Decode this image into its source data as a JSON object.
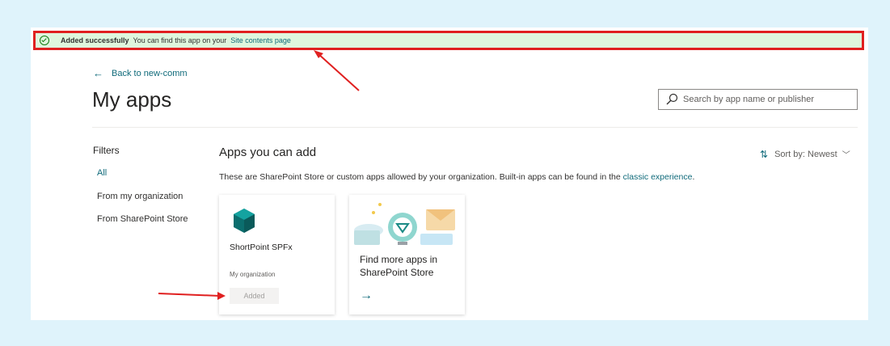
{
  "banner": {
    "strong": "Added successfully",
    "message": "You can find this app on your",
    "link": "Site contents page"
  },
  "back_link": "Back to new-comm",
  "page_title": "My apps",
  "search_placeholder": "Search by app name or publisher",
  "filters": {
    "title": "Filters",
    "items": [
      "All",
      "From my organization",
      "From SharePoint Store"
    ]
  },
  "section": {
    "title": "Apps you can add",
    "description": "These are SharePoint Store or custom apps allowed by your organization. Built-in apps can be found in the",
    "description_link": "classic experience",
    "description_end": "."
  },
  "sort": {
    "label": "Sort by:",
    "value": "Newest"
  },
  "cards": [
    {
      "name": "ShortPoint SPFx",
      "publisher": "My organization",
      "button": "Added"
    },
    {
      "cta": "Find more apps in SharePoint Store"
    }
  ],
  "colors": {
    "accent": "#0f6a7a",
    "success_bg": "#dff6dd",
    "annotation": "#e02020"
  }
}
